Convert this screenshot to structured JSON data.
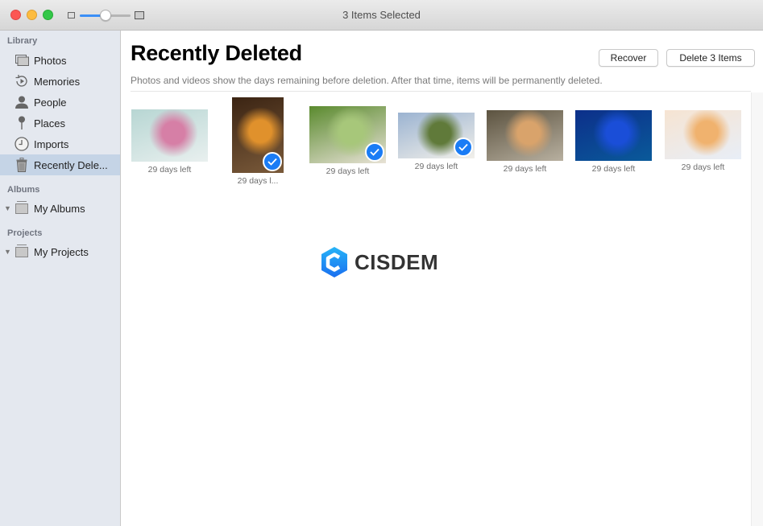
{
  "window": {
    "title": "3 Items Selected",
    "zoom_slider_value": 0.5
  },
  "sidebar": {
    "sections": [
      {
        "label": "Library",
        "items": [
          {
            "label": "Photos",
            "icon": "photos-icon",
            "selected": false
          },
          {
            "label": "Memories",
            "icon": "memories-icon",
            "selected": false
          },
          {
            "label": "People",
            "icon": "people-icon",
            "selected": false
          },
          {
            "label": "Places",
            "icon": "places-pin-icon",
            "selected": false
          },
          {
            "label": "Imports",
            "icon": "clock-icon",
            "selected": false
          },
          {
            "label": "Recently Dele...",
            "icon": "trash-icon",
            "selected": true
          }
        ]
      },
      {
        "label": "Albums",
        "items": [
          {
            "label": "My Albums",
            "icon": "album-stack-icon",
            "expanded": true
          }
        ]
      },
      {
        "label": "Projects",
        "items": [
          {
            "label": "My Projects",
            "icon": "project-stack-icon",
            "expanded": true
          }
        ]
      }
    ]
  },
  "main": {
    "title": "Recently Deleted",
    "subtitle": "Photos and videos show the days remaining before deletion. After that time, items will be permanently deleted.",
    "buttons": {
      "recover": "Recover",
      "delete": "Delete 3 Items"
    },
    "photos": [
      {
        "caption": "29 days left",
        "subject": "pink rose",
        "selected": false,
        "colors": [
          "#b7d6d3",
          "#d67fa6",
          "#e9f0ef"
        ]
      },
      {
        "caption": "29 days l...",
        "subject": "deer at sunset",
        "selected": true,
        "colors": [
          "#3b2413",
          "#e0912c",
          "#7a5a3a"
        ]
      },
      {
        "caption": "29 days left",
        "subject": "family on bench",
        "selected": true,
        "colors": [
          "#5a8a2e",
          "#a7c77a",
          "#e8e2d6"
        ]
      },
      {
        "caption": "29 days left",
        "subject": "leaping lamb",
        "selected": true,
        "colors": [
          "#9bb3d1",
          "#607a3a",
          "#f2f0ea"
        ]
      },
      {
        "caption": "29 days left",
        "subject": "woman in park",
        "selected": false,
        "colors": [
          "#5c5340",
          "#d9a36b",
          "#b8b0a0"
        ]
      },
      {
        "caption": "29 days left",
        "subject": "blue rose",
        "selected": false,
        "colors": [
          "#0c2f8a",
          "#1a4ed8",
          "#0a5a9a"
        ]
      },
      {
        "caption": "29 days left",
        "subject": "screenshot",
        "selected": false,
        "colors": [
          "#f6e4d2",
          "#f0b26e",
          "#e8eef7"
        ]
      }
    ]
  },
  "watermark": {
    "text": "CISDEM",
    "color": "#1e88f0"
  }
}
